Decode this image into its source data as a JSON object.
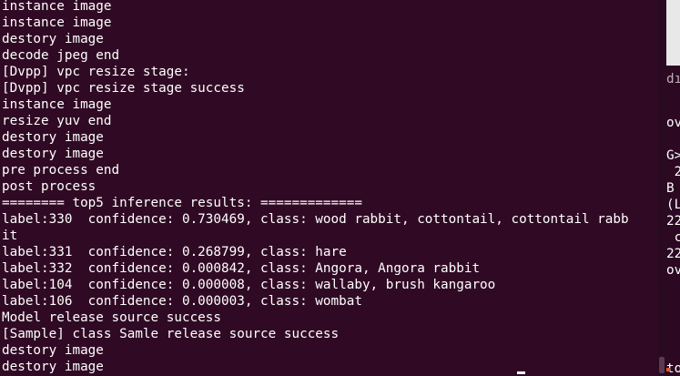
{
  "terminal": {
    "lines": [
      "instance image",
      "instance image",
      "destory image",
      "decode jpeg end",
      "[Dvpp] vpc resize stage:",
      "[Dvpp] vpc resize stage success",
      "instance image",
      "resize yuv end",
      "destory image",
      "destory image",
      "pre process end",
      "post process",
      "======== top5 inference results: =============",
      "label:330  confidence: 0.730469, class: wood rabbit, cottontail, cottontail rabb",
      "it",
      "label:331  confidence: 0.268799, class: hare",
      "label:332  confidence: 0.000842, class: Angora, Angora rabbit",
      "label:104  confidence: 0.000008, class: wallaby, brush kangaroo",
      "label:106  confidence: 0.000003, class: wombat",
      "Model release source success",
      "[Sample] class Samle release source success",
      "destory image",
      "destory image"
    ]
  },
  "background_window": {
    "peek_lines": [
      {
        "text": "dı"
      },
      {
        "text": "ov"
      },
      {
        "text": "G>"
      },
      {
        "text": " 2"
      },
      {
        "text": "B"
      },
      {
        "text": "(L"
      },
      {
        "text": "22"
      },
      {
        "text": " c"
      },
      {
        "text": "22"
      },
      {
        "text": "ov"
      },
      {
        "text": "to"
      }
    ]
  },
  "colors": {
    "terminal_bg": "#300a24",
    "text": "#ffffff"
  }
}
